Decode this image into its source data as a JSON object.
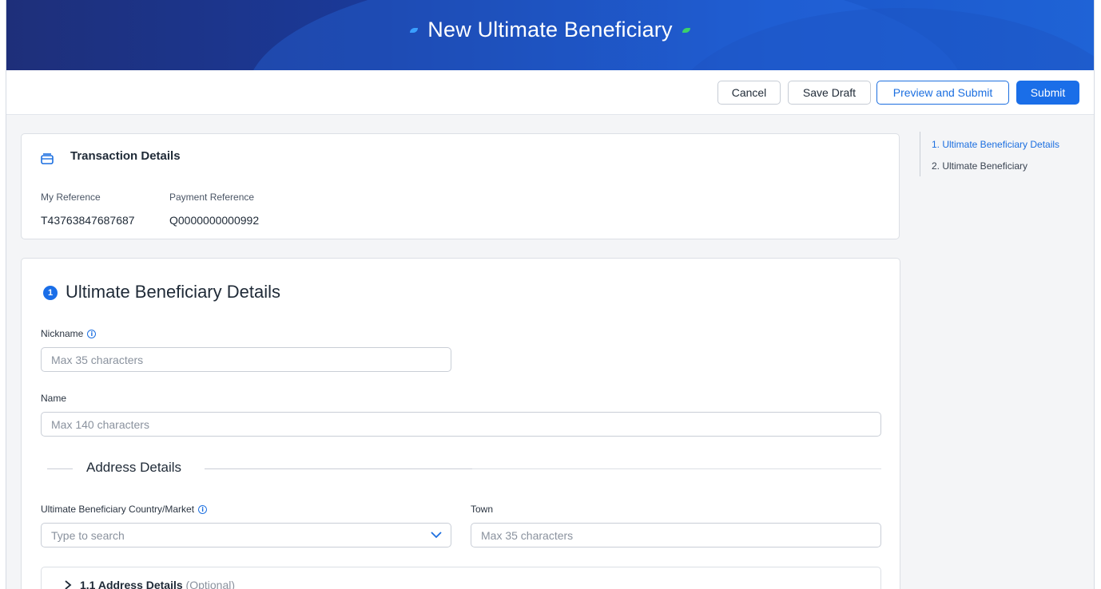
{
  "header": {
    "title": "New Ultimate Beneficiary"
  },
  "toolbar": {
    "cancel_label": "Cancel",
    "save_draft_label": "Save Draft",
    "preview_label": "Preview and Submit",
    "submit_label": "Submit"
  },
  "transaction": {
    "title": "Transaction Details",
    "my_reference_label": "My Reference",
    "my_reference_value": "T43763847687687",
    "payment_reference_label": "Payment Reference",
    "payment_reference_value": "Q0000000000992"
  },
  "beneficiary": {
    "step_number": "1",
    "title": "Ultimate Beneficiary Details",
    "nickname_label": "Nickname",
    "nickname_placeholder": "Max 35 characters",
    "name_label": "Name",
    "name_placeholder": "Max 140 characters",
    "address_section_title": "Address Details",
    "country_label": "Ultimate Beneficiary Country/Market",
    "country_placeholder": "Type to search",
    "town_label": "Town",
    "town_placeholder": "Max 35 characters",
    "address_subsection_title": "1.1 Address Details",
    "address_subsection_optional": "(Optional)"
  },
  "side_nav": {
    "items": [
      {
        "label": "1. Ultimate Beneficiary Details",
        "active": true
      },
      {
        "label": "2. Ultimate Beneficiary",
        "active": false
      }
    ]
  },
  "colors": {
    "primary": "#1a6ee8",
    "banner_start": "#1e2f7a",
    "banner_end": "#1f63d6"
  }
}
